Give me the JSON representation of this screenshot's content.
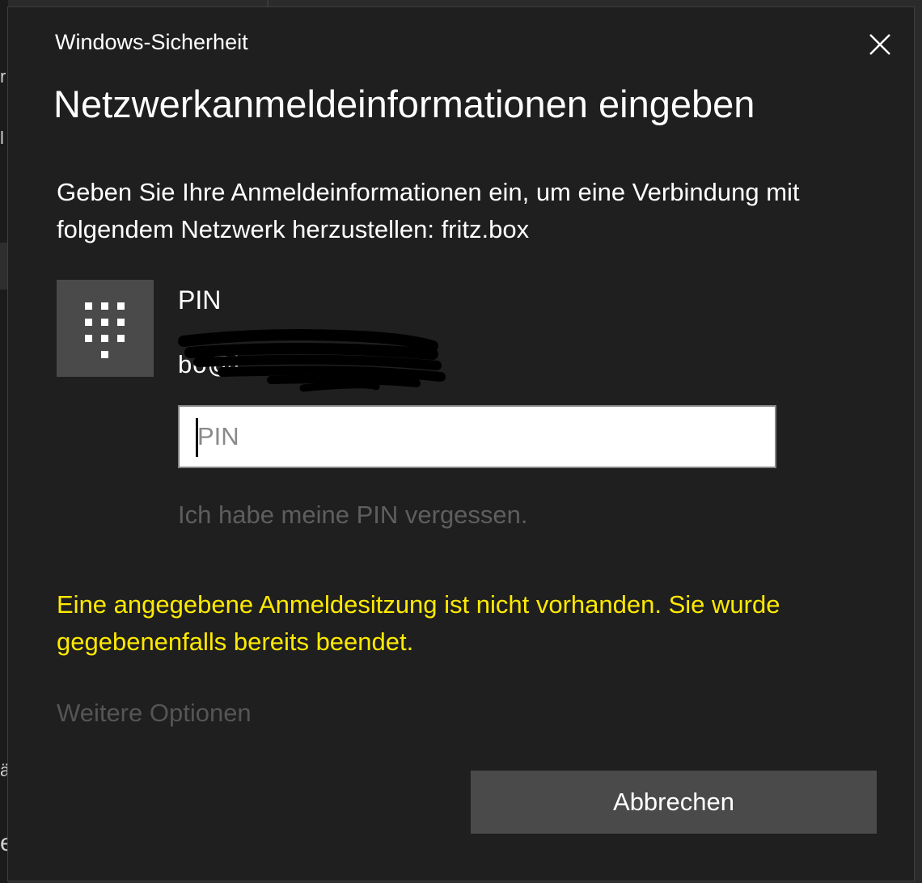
{
  "background": {
    "glyphs": [
      "r",
      "l",
      "ä",
      "e"
    ]
  },
  "dialog": {
    "caption": "Windows-Sicherheit",
    "close_icon": "close-icon",
    "heading": "Netzwerkanmeldeinformationen eingeben",
    "description": "Geben Sie Ihre Anmeldeinformationen ein, um eine Verbindung mit folgendem Netzwerk herzustellen: fritz.box",
    "credential": {
      "icon": "pin-keypad-icon",
      "title": "PIN",
      "username": "bo@i"
    },
    "pin_field": {
      "placeholder": "PIN",
      "value": ""
    },
    "forgot_pin_link": "Ich habe meine PIN vergessen.",
    "error_message": "Eine angegebene Anmeldesitzung ist nicht vorhanden. Sie wurde gegebenenfalls bereits beendet.",
    "more_options_link": "Weitere Optionen",
    "cancel_button": "Abbrechen"
  },
  "colors": {
    "dialog_background": "#1f1f1f",
    "error_text": "#ffea00",
    "disabled_link": "#5e5e5e",
    "button_background": "#4a4a4a"
  }
}
